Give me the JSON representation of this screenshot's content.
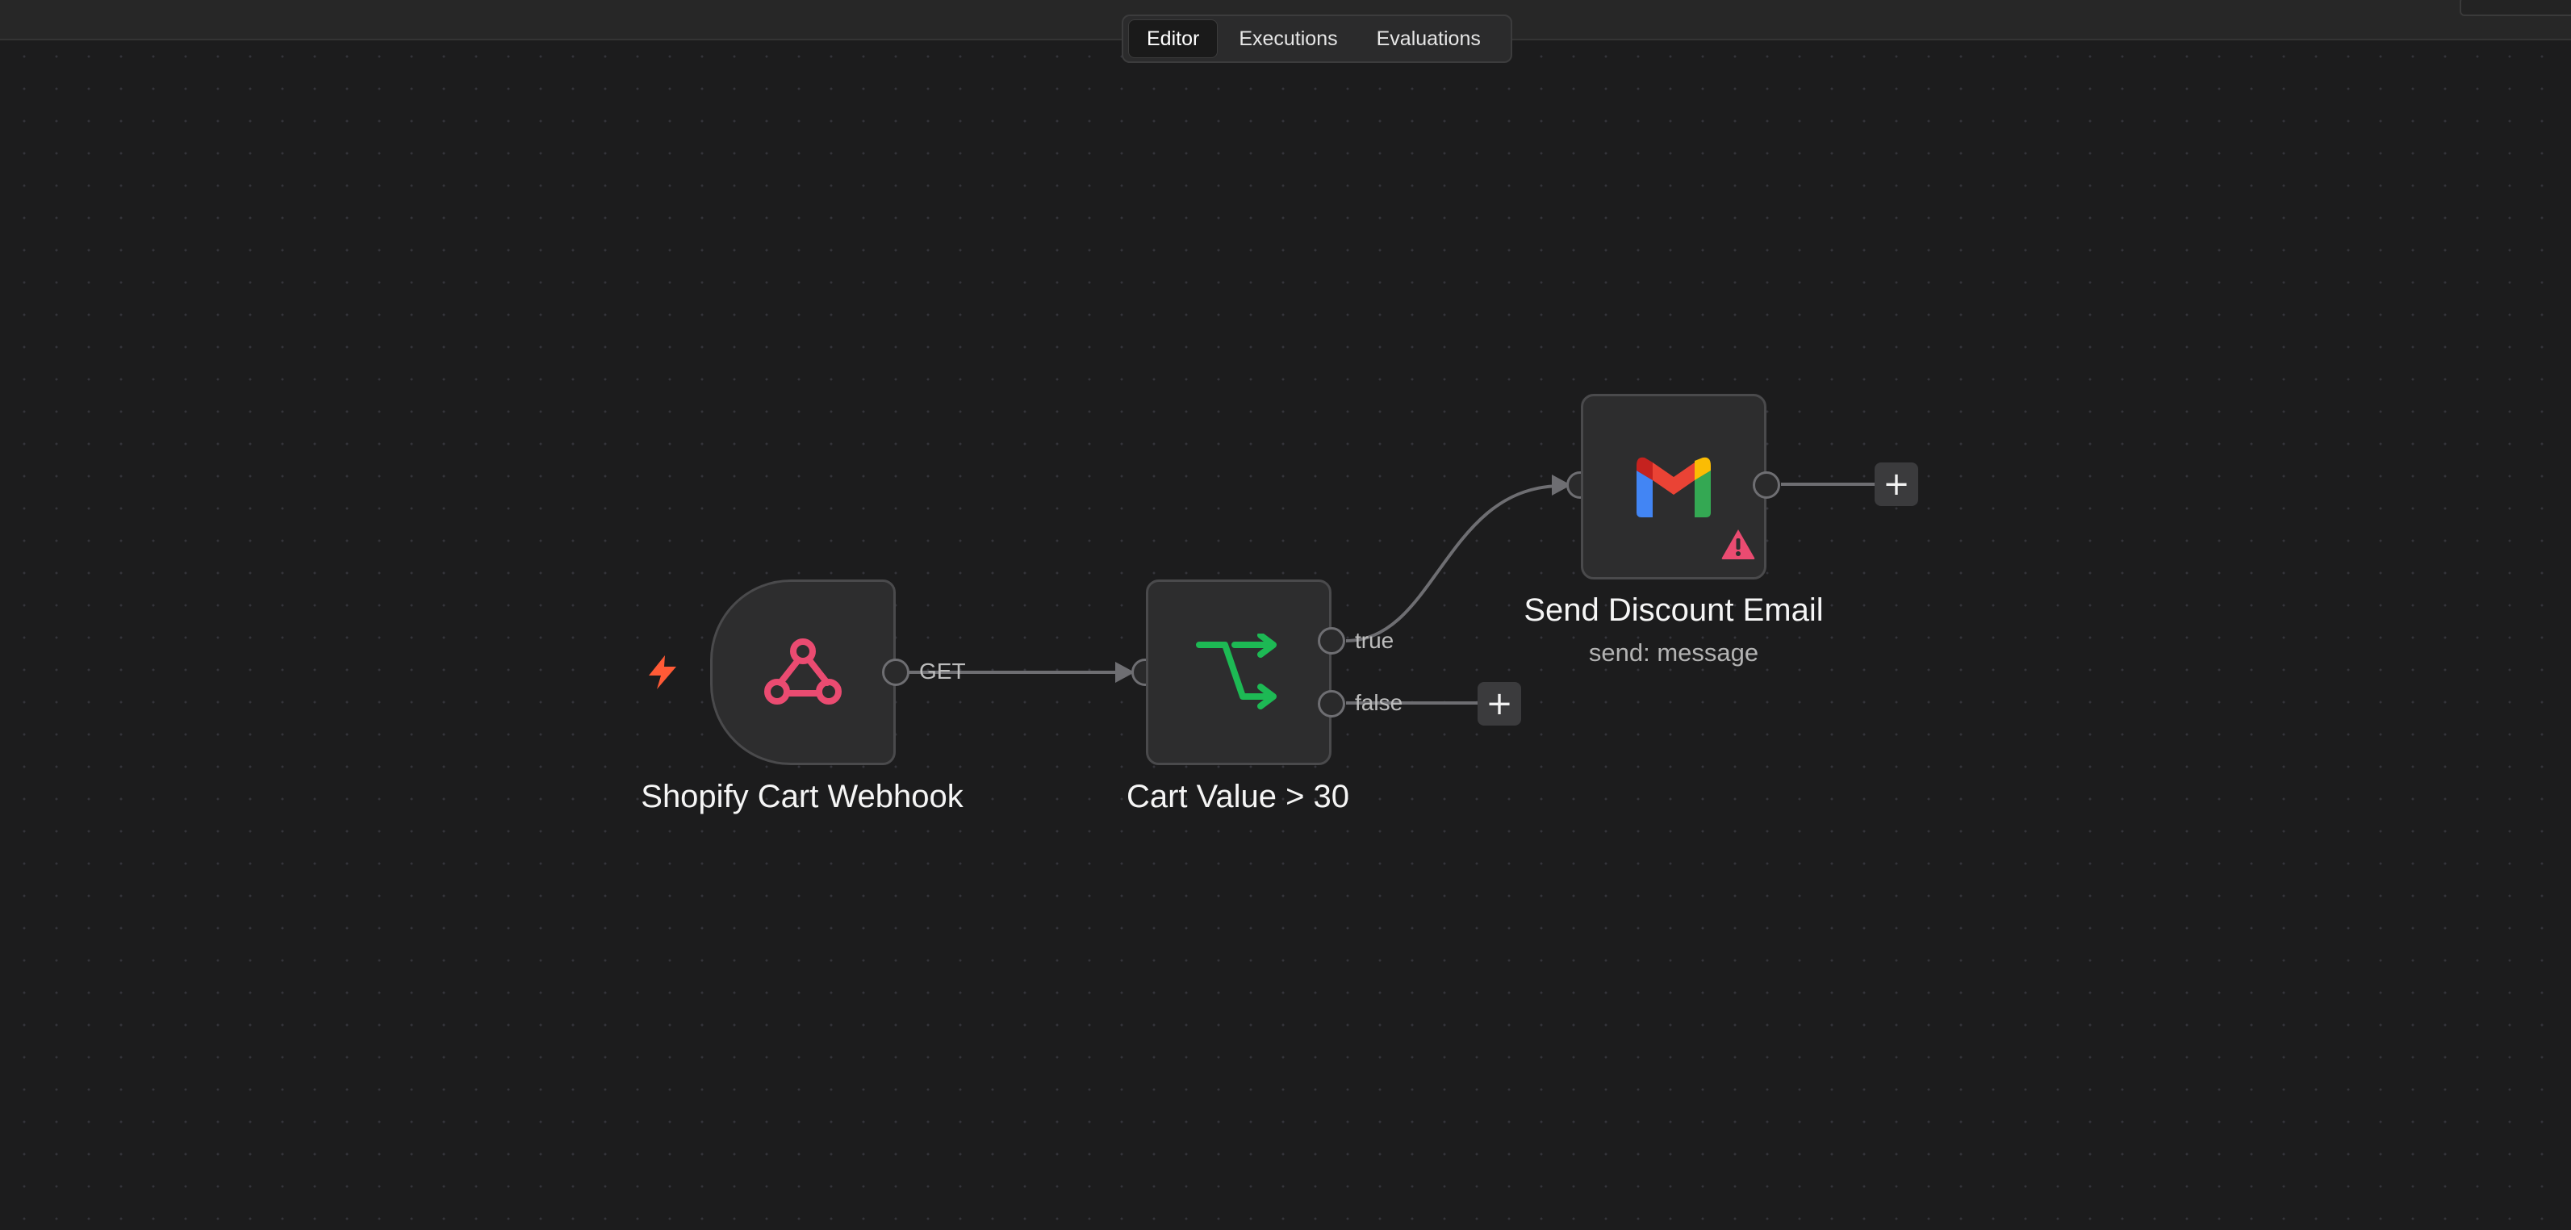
{
  "header": {
    "tabs": [
      {
        "label": "Editor",
        "active": true
      },
      {
        "label": "Executions",
        "active": false
      },
      {
        "label": "Evaluations",
        "active": false
      }
    ]
  },
  "nodes": {
    "webhook": {
      "title": "Shopify Cart Webhook",
      "icon": "webhook-icon",
      "output_label": "GET",
      "trigger_icon": "lightning-bolt-icon",
      "color": "#ea4b71"
    },
    "if": {
      "title": "Cart Value > 30",
      "icon": "branch-icon",
      "true_label": "true",
      "false_label": "false",
      "color": "#1db954"
    },
    "gmail": {
      "title": "Send Discount Email",
      "subtitle": "send: message",
      "icon": "gmail-icon",
      "status_icon": "warning-icon",
      "warning_color": "#ea4b71"
    }
  },
  "colors": {
    "canvas": "#1c1c1d",
    "node_bg": "#2d2d2e",
    "edge": "#6e6e72",
    "trigger_bolt": "#ff5a36"
  }
}
